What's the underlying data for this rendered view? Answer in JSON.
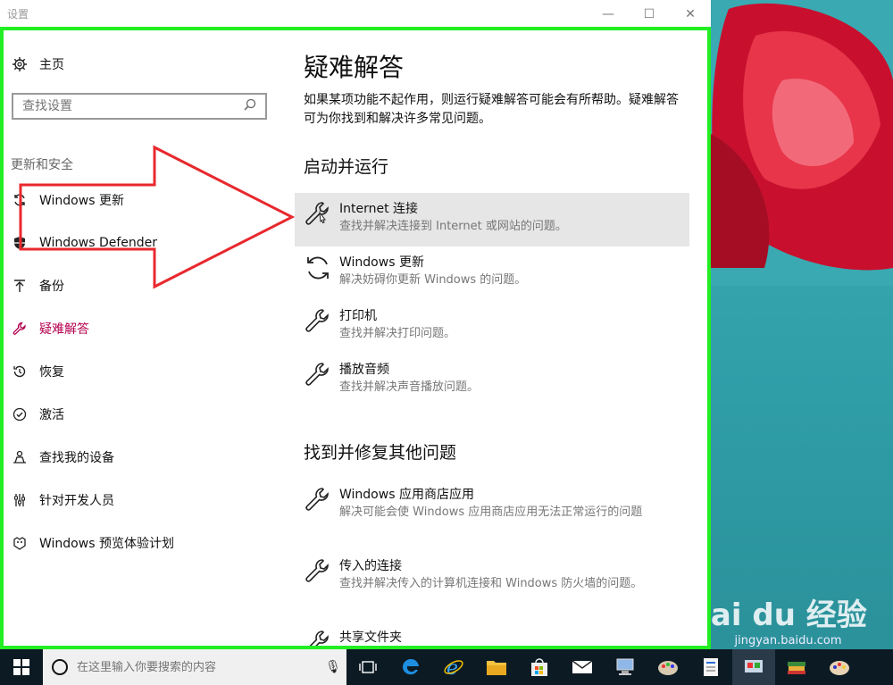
{
  "window": {
    "title": "设置",
    "minimize": "—",
    "maximize": "☐",
    "close": "✕"
  },
  "sidebar": {
    "home": "主页",
    "search_placeholder": "查找设置",
    "section": "更新和安全",
    "items": [
      {
        "label": "Windows 更新",
        "icon": "refresh-icon"
      },
      {
        "label": "Windows Defender",
        "icon": "shield-icon"
      },
      {
        "label": "备份",
        "icon": "upload-icon"
      },
      {
        "label": "疑难解答",
        "icon": "wrench-icon",
        "active": true
      },
      {
        "label": "恢复",
        "icon": "history-icon"
      },
      {
        "label": "激活",
        "icon": "check-circle-icon"
      },
      {
        "label": "查找我的设备",
        "icon": "person-location-icon"
      },
      {
        "label": "针对开发人员",
        "icon": "developer-icon"
      },
      {
        "label": "Windows 预览体验计划",
        "icon": "insider-icon"
      }
    ]
  },
  "content": {
    "title": "疑难解答",
    "intro": "如果某项功能不起作用，则运行疑难解答可能会有所帮助。疑难解答可为你找到和解决许多常见问题。",
    "section1": "启动并运行",
    "section2": "找到并修复其他问题",
    "items1": [
      {
        "name": "Internet 连接",
        "desc": "查找并解决连接到 Internet 或网站的问题。"
      },
      {
        "name": "Windows 更新",
        "desc": "解决妨碍你更新 Windows 的问题。"
      },
      {
        "name": "打印机",
        "desc": "查找并解决打印问题。"
      },
      {
        "name": "播放音频",
        "desc": "查找并解决声音播放问题。"
      }
    ],
    "items2": [
      {
        "name": "Windows 应用商店应用",
        "desc": "解决可能会使 Windows 应用商店应用无法正常运行的问题"
      },
      {
        "name": "传入的连接",
        "desc": "查找并解决传入的计算机连接和 Windows 防火墙的问题。"
      },
      {
        "name": "共享文件夹",
        "desc": ""
      }
    ]
  },
  "taskbar": {
    "search_placeholder": "在这里输入你要搜索的内容"
  },
  "watermark": {
    "brand": "Bai du 经验",
    "url": "jingyan.baidu.com"
  },
  "colors": {
    "accent": "#b4004e",
    "highlight_frame": "#22ee22",
    "arrow": "#e8282e",
    "hover_bg": "#e6e6e6"
  }
}
